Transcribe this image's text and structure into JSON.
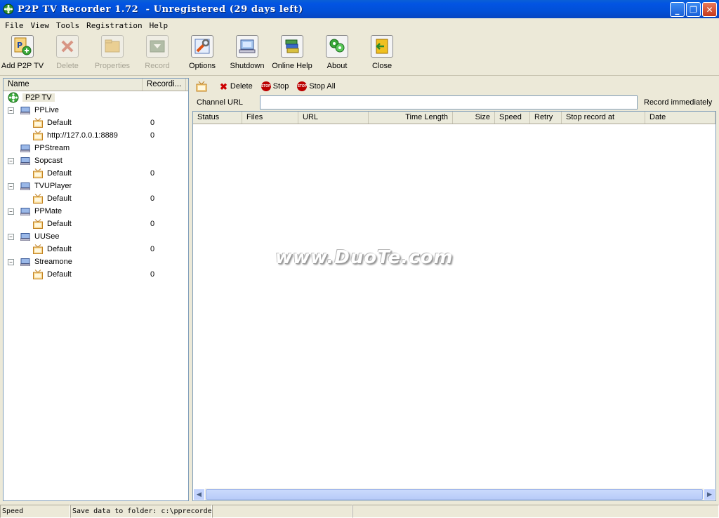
{
  "window": {
    "title": "P2P TV Recorder 1.72  - Unregistered (29 days left)",
    "controls": [
      "_",
      "❐",
      "✕"
    ]
  },
  "menu": [
    "File",
    "View",
    "Tools",
    "Registration",
    "Help"
  ],
  "toolbar": [
    {
      "label": "Add P2P TV",
      "icon": "add-p2ptv-icon",
      "enabled": true
    },
    {
      "label": "Delete",
      "icon": "delete-icon",
      "enabled": false
    },
    {
      "label": "Properties",
      "icon": "properties-icon",
      "enabled": false
    },
    {
      "label": "Record",
      "icon": "record-icon",
      "enabled": false
    },
    {
      "label": "Options",
      "icon": "options-icon",
      "enabled": true
    },
    {
      "label": "Shutdown",
      "icon": "shutdown-icon",
      "enabled": true
    },
    {
      "label": "Online Help",
      "icon": "online-help-icon",
      "enabled": true
    },
    {
      "label": "About",
      "icon": "about-icon",
      "enabled": true
    },
    {
      "label": "Close",
      "icon": "close-icon",
      "enabled": true
    }
  ],
  "tree": {
    "columns": [
      "Name",
      "Recordi..."
    ],
    "root": "P2P TV",
    "groups": [
      {
        "name": "PPLive",
        "channels": [
          {
            "name": "Default",
            "count": "0"
          },
          {
            "name": "http://127.0.0.1:8889",
            "count": "0"
          }
        ]
      },
      {
        "name": "PPStream",
        "channels": []
      },
      {
        "name": "Sopcast",
        "channels": [
          {
            "name": "Default",
            "count": "0"
          }
        ]
      },
      {
        "name": "TVUPlayer",
        "channels": [
          {
            "name": "Default",
            "count": "0"
          }
        ]
      },
      {
        "name": "PPMate",
        "channels": [
          {
            "name": "Default",
            "count": "0"
          }
        ]
      },
      {
        "name": "UUSee",
        "channels": [
          {
            "name": "Default",
            "count": "0"
          }
        ]
      },
      {
        "name": "Streamone",
        "channels": [
          {
            "name": "Default",
            "count": "0"
          }
        ]
      }
    ]
  },
  "record_toolbar": {
    "delete": "Delete",
    "stop": "Stop",
    "stop_all": "Stop All",
    "stop_badge": "STOP"
  },
  "channel_url": {
    "label": "Channel URL",
    "value": "",
    "record_immediately": "Record immediately"
  },
  "list_columns": [
    "Status",
    "Files",
    "URL",
    "Time Length",
    "Size",
    "Speed",
    "Retry",
    "Stop record at",
    "Date"
  ],
  "watermark": "www.DuoTe.com",
  "statusbar": {
    "speed": "Speed",
    "folder": "Save data to folder: c:\\pprecorde",
    "extra": ""
  }
}
